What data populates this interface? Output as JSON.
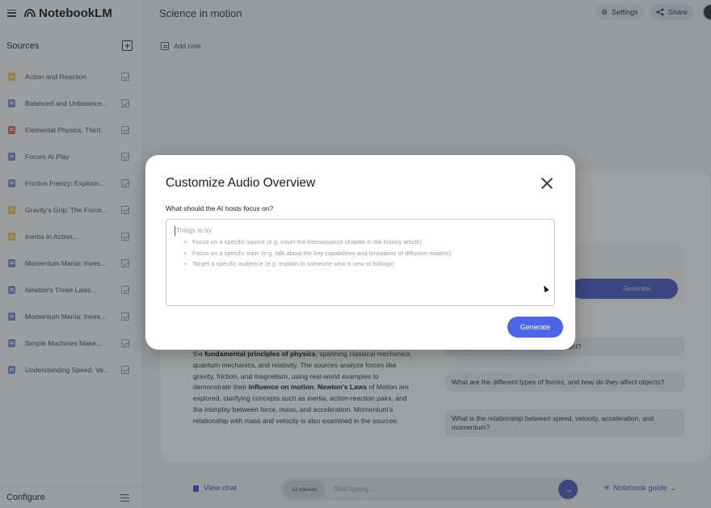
{
  "app": {
    "name": "NotebookLM",
    "notebook_title": "Science in motion"
  },
  "topbar": {
    "settings_label": "Settings",
    "share_label": "Share"
  },
  "sidebar": {
    "title": "Sources",
    "items": [
      {
        "label": "Action and Reaction",
        "icon": "yellow"
      },
      {
        "label": "Balanced and Unbalance...",
        "icon": "blue"
      },
      {
        "label": "Elemental Physics, Third...",
        "icon": "red"
      },
      {
        "label": "Forces At Play",
        "icon": "blue"
      },
      {
        "label": "Friction Frenzy: Explorin...",
        "icon": "blue"
      },
      {
        "label": "Gravity's Grip: The Force...",
        "icon": "yellow"
      },
      {
        "label": "Inertia In Action...",
        "icon": "yellow"
      },
      {
        "label": "Momentum Mania: Inves...",
        "icon": "blue"
      },
      {
        "label": "Newton's Three Laws...",
        "icon": "blue"
      },
      {
        "label": "Momentum Mania: Inves...",
        "icon": "blue"
      },
      {
        "label": "Simple Machines Make...",
        "icon": "blue"
      },
      {
        "label": "Understanding Speed, Ve...",
        "icon": "blue"
      }
    ],
    "configure_label": "Configure"
  },
  "main": {
    "add_note_label": "Add note",
    "summary": {
      "t1": "the ",
      "b1": "fundamental principles of physics",
      "t2": ", spanning classical mechanics, quantum mechanics, and relativity. The sources analyze forces like gravity, friction, and magnetism, using real-world examples to demonstrate their ",
      "b2": "influence on motion",
      "t3": ". ",
      "b3": "Newton's Laws",
      "t4": " of Motion are explored, clarifying concepts such as inertia, action-reaction pairs, and the interplay between force, mass, and acceleration. Momentum's relationship with mass and velocity is also examined in the sources."
    },
    "background_generate_label": "Generate",
    "suggestions": [
      "on explain how objects move and interact?",
      "What are the different types of forces, and how do they affect objects?",
      "What is the relationship between speed, velocity, acceleration, and momentum?"
    ],
    "chat": {
      "view_chat_label": "View chat",
      "sources_count": "12 sources",
      "placeholder": "Start typing...",
      "guide_label": "Notebook guide"
    }
  },
  "modal": {
    "title": "Customize Audio Overview",
    "question": "What should the AI hosts focus on?",
    "placeholder_title": "Things to try",
    "placeholder_items": [
      "Focus on a specific source (e.g. cover the Renaissance chapter in the history article)",
      "Focus on a specific topic (e.g. talk about the key capabilities and limitations of diffusion models)",
      "Target a specific audience (e.g. explain to someone who is new to biology)"
    ],
    "generate_label": "Generate"
  },
  "colors": {
    "accent": "#4a65e8",
    "overlay": "rgba(32,33,36,0.42)"
  }
}
